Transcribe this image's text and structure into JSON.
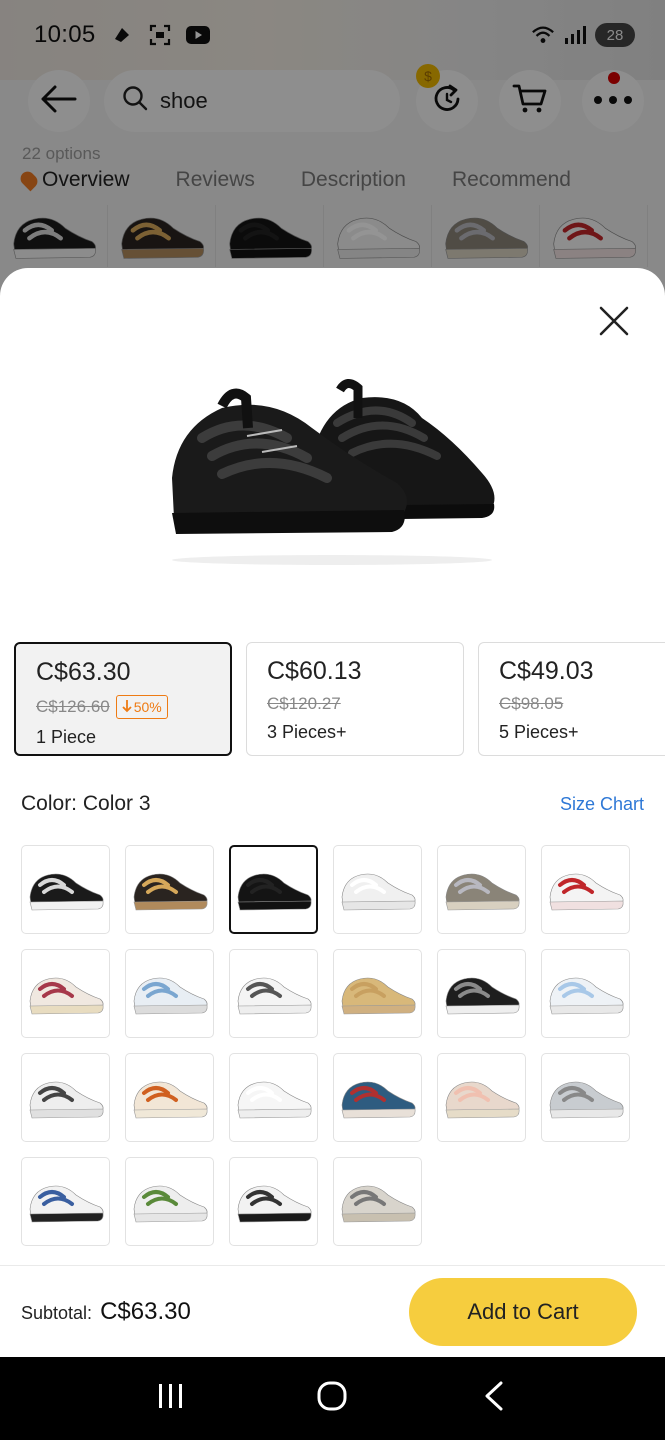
{
  "status_bar": {
    "time": "10:05",
    "battery": "28",
    "icons": [
      "notification-icon",
      "screen-capture-icon",
      "youtube-icon",
      "wifi-icon",
      "signal-icon"
    ]
  },
  "top_nav": {
    "search_query": "shoe",
    "icons": [
      "back-arrow-icon",
      "search-icon",
      "refresh-icon",
      "cart-icon",
      "more-icon"
    ]
  },
  "product_tabs": {
    "options_count": "22 options",
    "tabs": [
      "Overview",
      "Reviews",
      "Description",
      "Recommend"
    ]
  },
  "price_tiers": [
    {
      "price": "C$63.30",
      "original": "C$126.60",
      "discount": "50%",
      "quantity": "1 Piece",
      "selected": true
    },
    {
      "price": "C$60.13",
      "original": "C$120.27",
      "discount": "",
      "quantity": "3 Pieces+",
      "selected": false
    },
    {
      "price": "C$49.03",
      "original": "C$98.05",
      "discount": "",
      "quantity": "5 Pieces+",
      "selected": false
    }
  ],
  "color_selector": {
    "label": "Color: Color 3",
    "size_chart_label": "Size Chart",
    "selected_index": 2,
    "swatches": [
      {
        "name": "color-1",
        "body": "#1a1a1a",
        "lace": "#d8d8d8",
        "sole": "#f2f2f2"
      },
      {
        "name": "color-2",
        "body": "#2a2420",
        "lace": "#d6a85a",
        "sole": "#b08a5c"
      },
      {
        "name": "color-3",
        "body": "#141414",
        "lace": "#222222",
        "sole": "#111111"
      },
      {
        "name": "color-4",
        "body": "#f0f0f0",
        "lace": "#ffffff",
        "sole": "#e6e6e6"
      },
      {
        "name": "color-5",
        "body": "#8a8478",
        "lace": "#b8b8c0",
        "sole": "#d8d0c0"
      },
      {
        "name": "color-6",
        "body": "#f4f4f4",
        "lace": "#c0262a",
        "sole": "#f0e0e0"
      },
      {
        "name": "color-7",
        "body": "#f0e8e0",
        "lace": "#a6384a",
        "sole": "#e8dcc0"
      },
      {
        "name": "color-8",
        "body": "#e8eef4",
        "lace": "#7aa6d0",
        "sole": "#dcdcdc"
      },
      {
        "name": "color-9",
        "body": "#f4f4f4",
        "lace": "#555555",
        "sole": "#eeeeee"
      },
      {
        "name": "color-10",
        "body": "#d8b87a",
        "lace": "#c8a060",
        "sole": "#d0b080"
      },
      {
        "name": "color-11",
        "body": "#1e1e1e",
        "lace": "#8a8a8a",
        "sole": "#eeeeee"
      },
      {
        "name": "color-12",
        "body": "#eef2f6",
        "lace": "#a8c8e8",
        "sole": "#e8e8e8"
      },
      {
        "name": "color-13",
        "body": "#eeeeee",
        "lace": "#444444",
        "sole": "#e0e0e0"
      },
      {
        "name": "color-14",
        "body": "#f2e6d6",
        "lace": "#d06020",
        "sole": "#f0e8d8"
      },
      {
        "name": "color-15",
        "body": "#f6f6f6",
        "lace": "#ffffff",
        "sole": "#eeeeee"
      },
      {
        "name": "color-16",
        "body": "#2e5c80",
        "lace": "#b03030",
        "sole": "#e8e0d8"
      },
      {
        "name": "color-17",
        "body": "#e8d8cc",
        "lace": "#f0c0b0",
        "sole": "#e6dcc8"
      },
      {
        "name": "color-18",
        "body": "#c8ccd0",
        "lace": "#888888",
        "sole": "#e8e8e8"
      },
      {
        "name": "color-19",
        "body": "#f2f2f2",
        "lace": "#3a5fa0",
        "sole": "#222222"
      },
      {
        "name": "color-20",
        "body": "#eeeeee",
        "lace": "#5a8a3a",
        "sole": "#e6e6e6"
      },
      {
        "name": "color-21",
        "body": "#f2f2f2",
        "lace": "#333333",
        "sole": "#1a1a1a"
      },
      {
        "name": "color-22",
        "body": "#d8d4cc",
        "lace": "#777777",
        "sole": "#c8c0b0"
      }
    ]
  },
  "action_bar": {
    "subtotal_label": "Subtotal:",
    "subtotal_value": "C$63.30",
    "add_to_cart_label": "Add to Cart"
  },
  "colors": {
    "accent_yellow": "#f6cd3e",
    "discount_orange": "#ee7b14",
    "link_blue": "#2e78d6"
  },
  "system_nav": {
    "icons": [
      "recent-apps-icon",
      "home-icon",
      "back-icon"
    ]
  }
}
